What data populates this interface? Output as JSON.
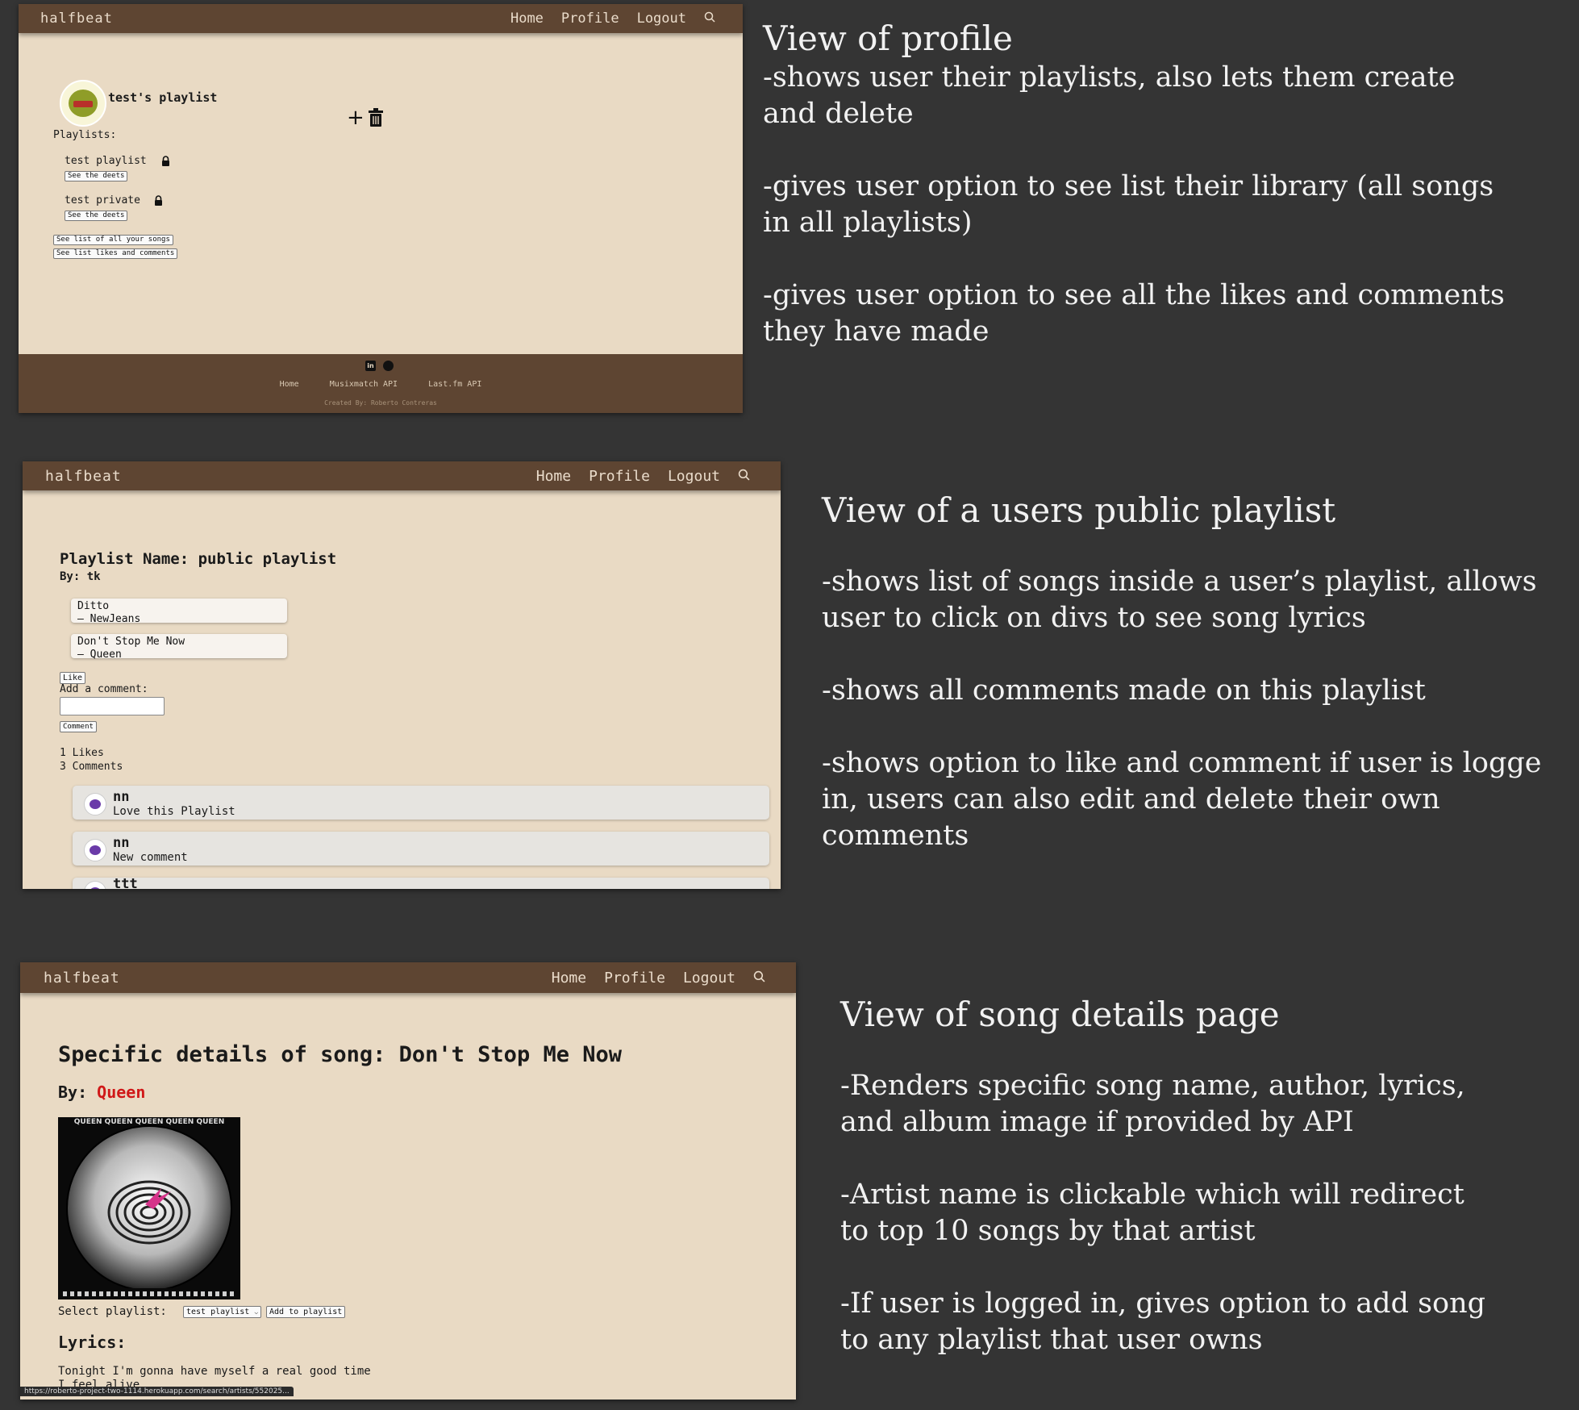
{
  "panel1": {
    "nav": {
      "brand": "halfbeat",
      "links": [
        "Home",
        "Profile",
        "Logout"
      ]
    },
    "title": "test's playlist",
    "playlists_label": "Playlists:",
    "playlists": [
      {
        "name": "test playlist",
        "button": "See the deets"
      },
      {
        "name": "test private",
        "button": "See the deets"
      }
    ],
    "all_songs_button": "See list of all your songs",
    "likes_comments_button": "See list likes and comments",
    "footer": {
      "links": [
        "Home",
        "Musixmatch API",
        "Last.fm API"
      ],
      "credit": "Created By: Roberto Contreras"
    },
    "description": {
      "heading": "View of profile",
      "lines": [
        "-shows user their playlists, also lets them create",
        "and delete",
        "",
        "-gives user option to see list their library (all songs",
        "in all playlists)",
        "",
        "-gives user option to see all the likes and comments",
        "they have made"
      ]
    }
  },
  "panel2": {
    "nav": {
      "brand": "halfbeat",
      "links": [
        "Home",
        "Profile",
        "Logout"
      ]
    },
    "playlist_name": "Playlist Name: public playlist",
    "by": "By: tk",
    "songs": [
      {
        "title": "Ditto",
        "artist": "– NewJeans"
      },
      {
        "title": "Don't Stop Me Now",
        "artist": "– Queen"
      }
    ],
    "like_button": "Like",
    "add_comment_label": "Add a comment:",
    "comment_button": "Comment",
    "likes": "1 Likes",
    "comments_count": "3 Comments",
    "comments": [
      {
        "user": "nn",
        "text": "Love this Playlist"
      },
      {
        "user": "nn",
        "text": "New comment"
      },
      {
        "user": "ttt",
        "text": ""
      }
    ],
    "description": {
      "heading": "View of a users public playlist",
      "lines": [
        "-shows list of songs inside a user’s playlist, allows",
        "user to click on divs to see song lyrics",
        "",
        "-shows all comments made on this playlist",
        "",
        "-shows option to like and comment if user is logge",
        "in, users can also edit and delete their own",
        "comments"
      ]
    }
  },
  "panel3": {
    "nav": {
      "brand": "halfbeat",
      "links": [
        "Home",
        "Profile",
        "Logout"
      ]
    },
    "title": "Specific details of song: Don't Stop Me Now",
    "by_label": "By:",
    "artist": "Queen",
    "album_banner": "QUEEN QUEEN QUEEN QUEEN QUEEN",
    "select_label": "Select playlist:",
    "select_value": "test playlist",
    "add_button": "Add to playlist",
    "lyrics_label": "Lyrics:",
    "lyrics": [
      "Tonight I'm gonna have myself a real good time",
      "I feel alive"
    ],
    "status_url": "https://roberto-project-two-1114.herokuapp.com/search/artists/552025...",
    "description": {
      "heading": "View of song details page",
      "lines": [
        "-Renders specific song name, author, lyrics,",
        "and album image if provided by API",
        "",
        "-Artist name is clickable which will redirect",
        "to top 10 songs by that artist",
        "",
        "-If user is logged in, gives option to add song",
        "to any playlist that user owns"
      ]
    }
  }
}
